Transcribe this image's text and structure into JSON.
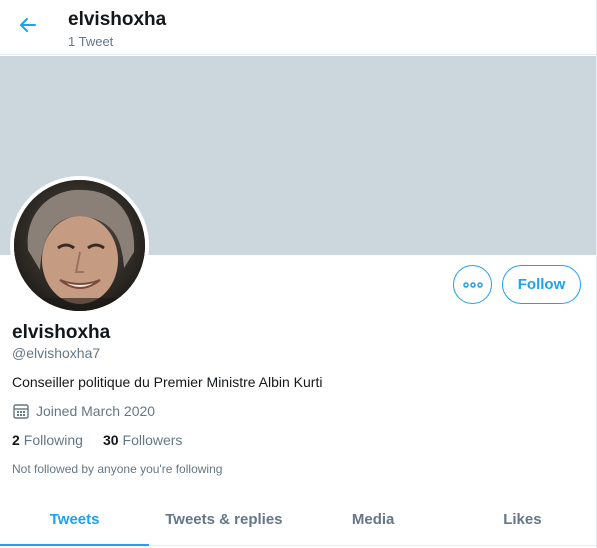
{
  "colors": {
    "accent": "#1da1f2",
    "banner": "#ccd6dd",
    "secondary_text": "#657786",
    "primary_text": "#14171a"
  },
  "header": {
    "back_icon": "arrow-left-icon",
    "name": "elvishoxha",
    "tweet_count": "1 Tweet"
  },
  "profile": {
    "display_name": "elvishoxha",
    "handle": "@elvishoxha7",
    "bio": "Conseiller politique du Premier Ministre Albin Kurti",
    "joined_icon": "calendar-icon",
    "joined": "Joined March 2020",
    "following_count": "2",
    "following_label": "Following",
    "followers_count": "30",
    "followers_label": "Followers",
    "not_followed": "Not followed by anyone you're following"
  },
  "actions": {
    "more_icon": "more-dots-icon",
    "follow_label": "Follow"
  },
  "tabs": [
    {
      "label": "Tweets",
      "active": true
    },
    {
      "label": "Tweets & replies",
      "active": false
    },
    {
      "label": "Media",
      "active": false
    },
    {
      "label": "Likes",
      "active": false
    }
  ]
}
